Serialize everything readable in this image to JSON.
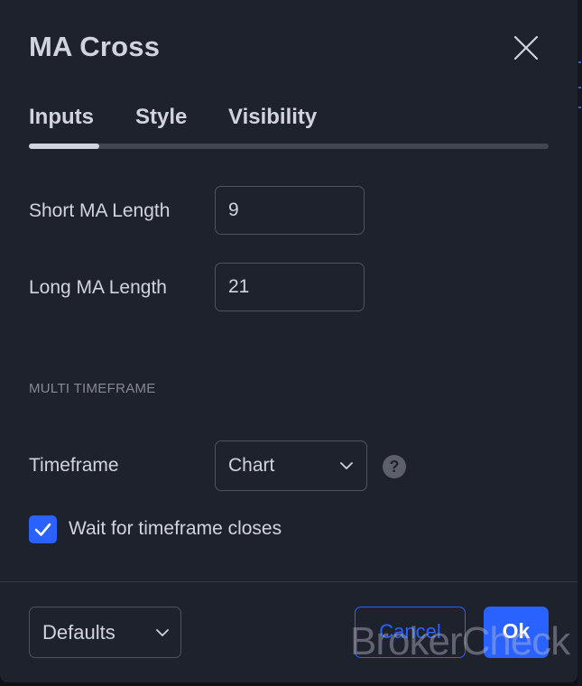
{
  "dialog": {
    "title": "MA Cross",
    "close_icon": "close-x-icon"
  },
  "tabs": [
    {
      "label": "Inputs",
      "active": true
    },
    {
      "label": "Style",
      "active": false
    },
    {
      "label": "Visibility",
      "active": false
    }
  ],
  "inputs": {
    "short_ma": {
      "label": "Short MA Length",
      "value": "9"
    },
    "long_ma": {
      "label": "Long MA Length",
      "value": "21"
    }
  },
  "multi_timeframe": {
    "section_title": "MULTI TIMEFRAME",
    "timeframe": {
      "label": "Timeframe",
      "value": "Chart",
      "help_icon": "question-icon",
      "help_glyph": "?"
    },
    "wait_closes": {
      "label": "Wait for timeframe closes",
      "checked": true
    }
  },
  "footer": {
    "defaults_label": "Defaults",
    "cancel_label": "Cancel",
    "ok_label": "Ok"
  },
  "watermark": "BrokerCheck",
  "colors": {
    "background": "#1e222d",
    "text": "#d1d4dc",
    "accent": "#2962ff",
    "border": "#50535e",
    "muted": "#868993"
  }
}
